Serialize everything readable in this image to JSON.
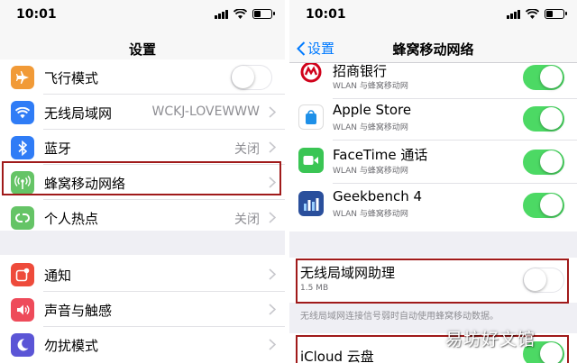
{
  "left": {
    "status": {
      "time": "10:01"
    },
    "nav_title": "设置",
    "rows_group1": [
      {
        "label": "飞行模式",
        "icon": "airplane-icon",
        "color": "#f19a37",
        "toggle": "off"
      },
      {
        "label": "无线局域网",
        "value": "WCKJ-LOVEWWW",
        "icon": "wifi-icon",
        "color": "#2f7cf6"
      },
      {
        "label": "蓝牙",
        "value": "关闭",
        "icon": "bluetooth-icon",
        "color": "#2f7cf6"
      },
      {
        "label": "蜂窝移动网络",
        "icon": "antenna-icon",
        "color": "#65c466",
        "highlighted": true
      },
      {
        "label": "个人热点",
        "value": "关闭",
        "icon": "hotspot-icon",
        "color": "#65c466"
      }
    ],
    "rows_group2": [
      {
        "label": "通知",
        "icon": "notification-icon",
        "color": "#ee4b3b"
      },
      {
        "label": "声音与触感",
        "icon": "speaker-icon",
        "color": "#ee4b5a"
      },
      {
        "label": "勿扰模式",
        "icon": "moon-icon",
        "color": "#5b55d6"
      }
    ]
  },
  "right": {
    "status": {
      "time": "10:01"
    },
    "back_label": "设置",
    "nav_title": "蜂窝移动网络",
    "apps": [
      {
        "name": "招商银行",
        "sub": "WLAN 与蜂窝移动网",
        "icon": "cmb-bank-icon",
        "color": "#d0021b"
      },
      {
        "name": "Apple Store",
        "sub": "WLAN 与蜂窝移动网",
        "icon": "apple-store-icon",
        "color": "#1e90e8"
      },
      {
        "name": "FaceTime 通话",
        "sub": "WLAN 与蜂窝移动网",
        "icon": "facetime-icon",
        "color": "#3ac554"
      },
      {
        "name": "Geekbench 4",
        "sub": "WLAN 与蜂窝移动网",
        "icon": "geekbench-icon",
        "color": "#2a4f9c"
      }
    ],
    "wifi_assist": {
      "label": "无线局域网助理",
      "size": "1.5 MB",
      "toggle": "off"
    },
    "footnote": "无线局域网连接信号弱时自动使用蜂窝移动数据。",
    "icloud": {
      "label": "iCloud 云盘",
      "toggle": "on"
    }
  },
  "watermark": "易坊好文馆",
  "colors": {
    "accent": "#007aff",
    "highlight": "#a01a1a",
    "toggle_on": "#4cd964"
  }
}
